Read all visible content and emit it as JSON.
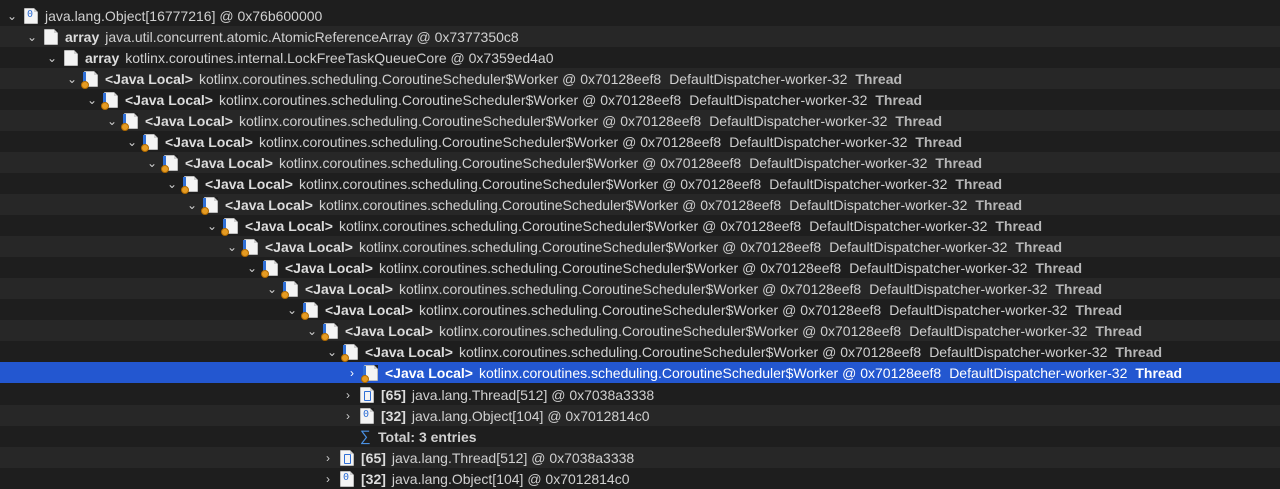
{
  "root": {
    "type": "java.lang.Object[16777216]",
    "addr": "@ 0x76b600000"
  },
  "rows": [
    {
      "kw": "array",
      "text": "java.util.concurrent.atomic.AtomicReferenceArray @ 0x7377350c8"
    },
    {
      "kw": "array",
      "text": "kotlinx.coroutines.internal.LockFreeTaskQueueCore @ 0x7359ed4a0"
    }
  ],
  "local": {
    "kw": "<Java Local>",
    "text": "kotlinx.coroutines.scheduling.CoroutineScheduler$Worker @ 0x70128eef8",
    "thread_name": "DefaultDispatcher-worker-32",
    "thread_label": "Thread"
  },
  "children": [
    {
      "kw": "[65]",
      "text": "java.lang.Thread[512] @ 0x7038a3338"
    },
    {
      "kw": "[32]",
      "text": "java.lang.Object[104] @ 0x7012814c0"
    }
  ],
  "total": "Total: 3 entries",
  "after": [
    {
      "kw": "[65]",
      "text": "java.lang.Thread[512] @ 0x7038a3338"
    },
    {
      "kw": "[32]",
      "text": "java.lang.Object[104] @ 0x7012814c0"
    }
  ]
}
